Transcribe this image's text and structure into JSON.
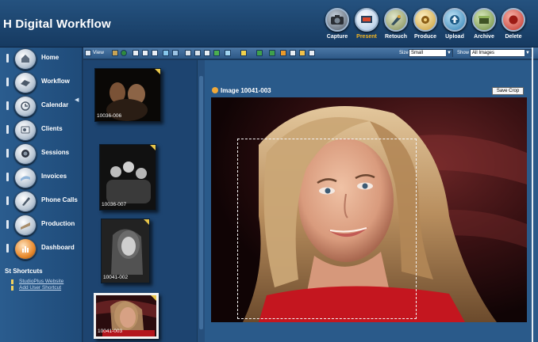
{
  "app": {
    "title": "H Digital Workflow"
  },
  "topnav": [
    {
      "label": "Capture",
      "icon": "camera-icon",
      "active": false,
      "color": "#505a66"
    },
    {
      "label": "Present",
      "icon": "present-icon",
      "active": true,
      "color": "#a6c3e2"
    },
    {
      "label": "Retouch",
      "icon": "retouch-icon",
      "active": false,
      "color": "#7f8a55"
    },
    {
      "label": "Produce",
      "icon": "produce-icon",
      "active": false,
      "color": "#c79b36"
    },
    {
      "label": "Upload",
      "icon": "upload-icon",
      "active": false,
      "color": "#2e7fb3"
    },
    {
      "label": "Archive",
      "icon": "archive-icon",
      "active": false,
      "color": "#6c8a3c"
    },
    {
      "label": "Delete",
      "icon": "delete-icon",
      "active": false,
      "color": "#c23229"
    }
  ],
  "sidebar": {
    "items": [
      {
        "label": "Home",
        "icon": "home-icon"
      },
      {
        "label": "Workflow",
        "icon": "workflow-icon"
      },
      {
        "label": "Calendar",
        "icon": "calendar-icon"
      },
      {
        "label": "Clients",
        "icon": "clients-icon"
      },
      {
        "label": "Sessions",
        "icon": "sessions-icon"
      },
      {
        "label": "Invoices",
        "icon": "invoices-icon"
      },
      {
        "label": "Phone Calls",
        "icon": "phone-icon"
      },
      {
        "label": "Production",
        "icon": "production-icon"
      },
      {
        "label": "Dashboard",
        "icon": "dashboard-icon"
      }
    ],
    "shortcuts_title": "St Shortcuts",
    "shortcuts": [
      "StudioPlus Website",
      "Add User Shortcut"
    ]
  },
  "toolbar": {
    "view_label": "View",
    "size_label": "Size",
    "size_value": "Small",
    "show_label": "Show",
    "show_value": "All Images"
  },
  "thumbnails": [
    {
      "id": "10036-006",
      "selected": false
    },
    {
      "id": "10036-007",
      "selected": false
    },
    {
      "id": "10041-002",
      "selected": false
    },
    {
      "id": "10041-003",
      "selected": true
    }
  ],
  "viewer": {
    "image_title": "Image 10041-003",
    "save_crop_label": "Save Crop"
  },
  "colors": {
    "accent": "#f4b521",
    "panel": "#2a5a8a",
    "sidebar": "#1f4b79",
    "background": "#1c3a5e"
  }
}
